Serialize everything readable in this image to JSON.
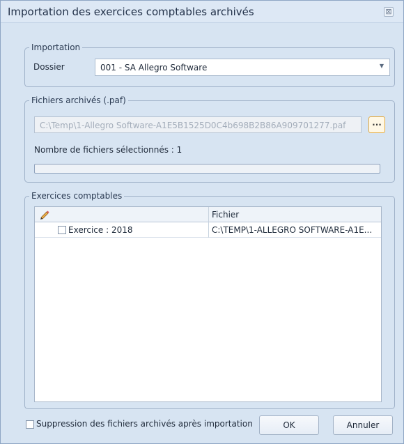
{
  "window": {
    "title": "Importation des exercices comptables archivés",
    "close_glyph": "⊠"
  },
  "importation": {
    "group_label": "Importation",
    "dossier_label": "Dossier",
    "dossier_value": "001 - SA Allegro Software",
    "dropdown_glyph": "▼"
  },
  "fichiers": {
    "group_label": "Fichiers archivés (.paf)",
    "path_value": "C:\\Temp\\1-Allegro Software-A1E5B1525D0C4b698B2B86A909701277.paf",
    "browse_label": "...",
    "count_text": "Nombre de fichiers sélectionnés : 1",
    "progress": 0
  },
  "exercices": {
    "group_label": "Exercices comptables",
    "columns": [
      "",
      "Fichier"
    ],
    "rows": [
      {
        "exercice": "Exercice : 2018",
        "checked": false,
        "fichier": "C:\\TEMP\\1-ALLEGRO SOFTWARE-A1E..."
      }
    ]
  },
  "footer": {
    "delete_checkbox_label": "Suppression des fichiers archivés après importation",
    "ok_label": "OK",
    "cancel_label": "Annuler"
  },
  "icons": {
    "edit": "pencil-icon",
    "close": "close-icon",
    "dropdown": "chevron-down-icon"
  }
}
